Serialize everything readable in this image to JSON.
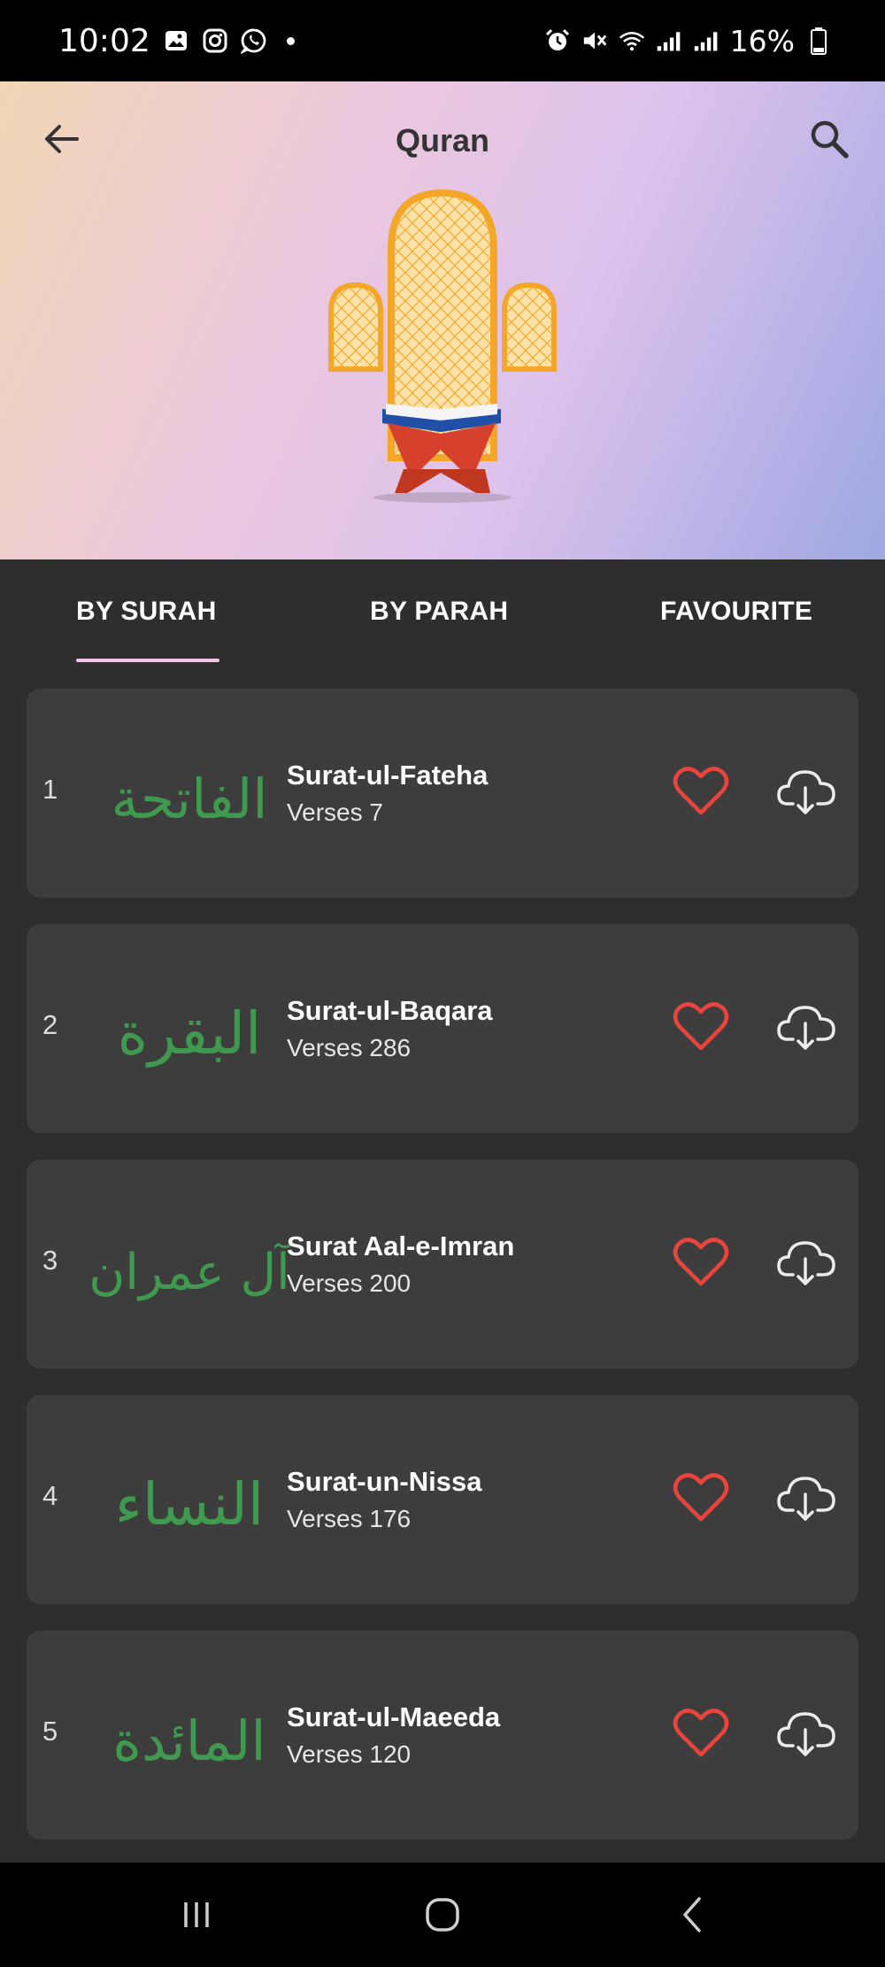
{
  "status_bar": {
    "time": "10:02",
    "battery": "16%"
  },
  "header": {
    "title": "Quran"
  },
  "tabs": [
    {
      "label": "BY SURAH",
      "active": true
    },
    {
      "label": "BY PARAH",
      "active": false
    },
    {
      "label": "FAVOURITE",
      "active": false
    }
  ],
  "surahs": [
    {
      "number": "1",
      "name": "Surat-ul-Fateha",
      "verses": "Verses 7",
      "arabic": "الفاتحة"
    },
    {
      "number": "2",
      "name": "Surat-ul-Baqara",
      "verses": "Verses 286",
      "arabic": "البقرة"
    },
    {
      "number": "3",
      "name": "Surat Aal-e-Imran",
      "verses": "Verses 200",
      "arabic": "آل عمران"
    },
    {
      "number": "4",
      "name": "Surat-un-Nissa",
      "verses": "Verses 176",
      "arabic": "النساء"
    },
    {
      "number": "5",
      "name": "Surat-ul-Maeeda",
      "verses": "Verses 120",
      "arabic": "المائدة"
    }
  ],
  "colors": {
    "calligraphy": "#3f9a4f",
    "heart": "#e8453f",
    "tab_indicator": "#f2c4e6",
    "card_bg": "#3d3d3d",
    "page_bg": "#2e2e2e"
  },
  "icons": {
    "back": "arrow-left-icon",
    "search": "search-icon",
    "favourite": "heart-outline-icon",
    "download": "cloud-download-icon"
  }
}
